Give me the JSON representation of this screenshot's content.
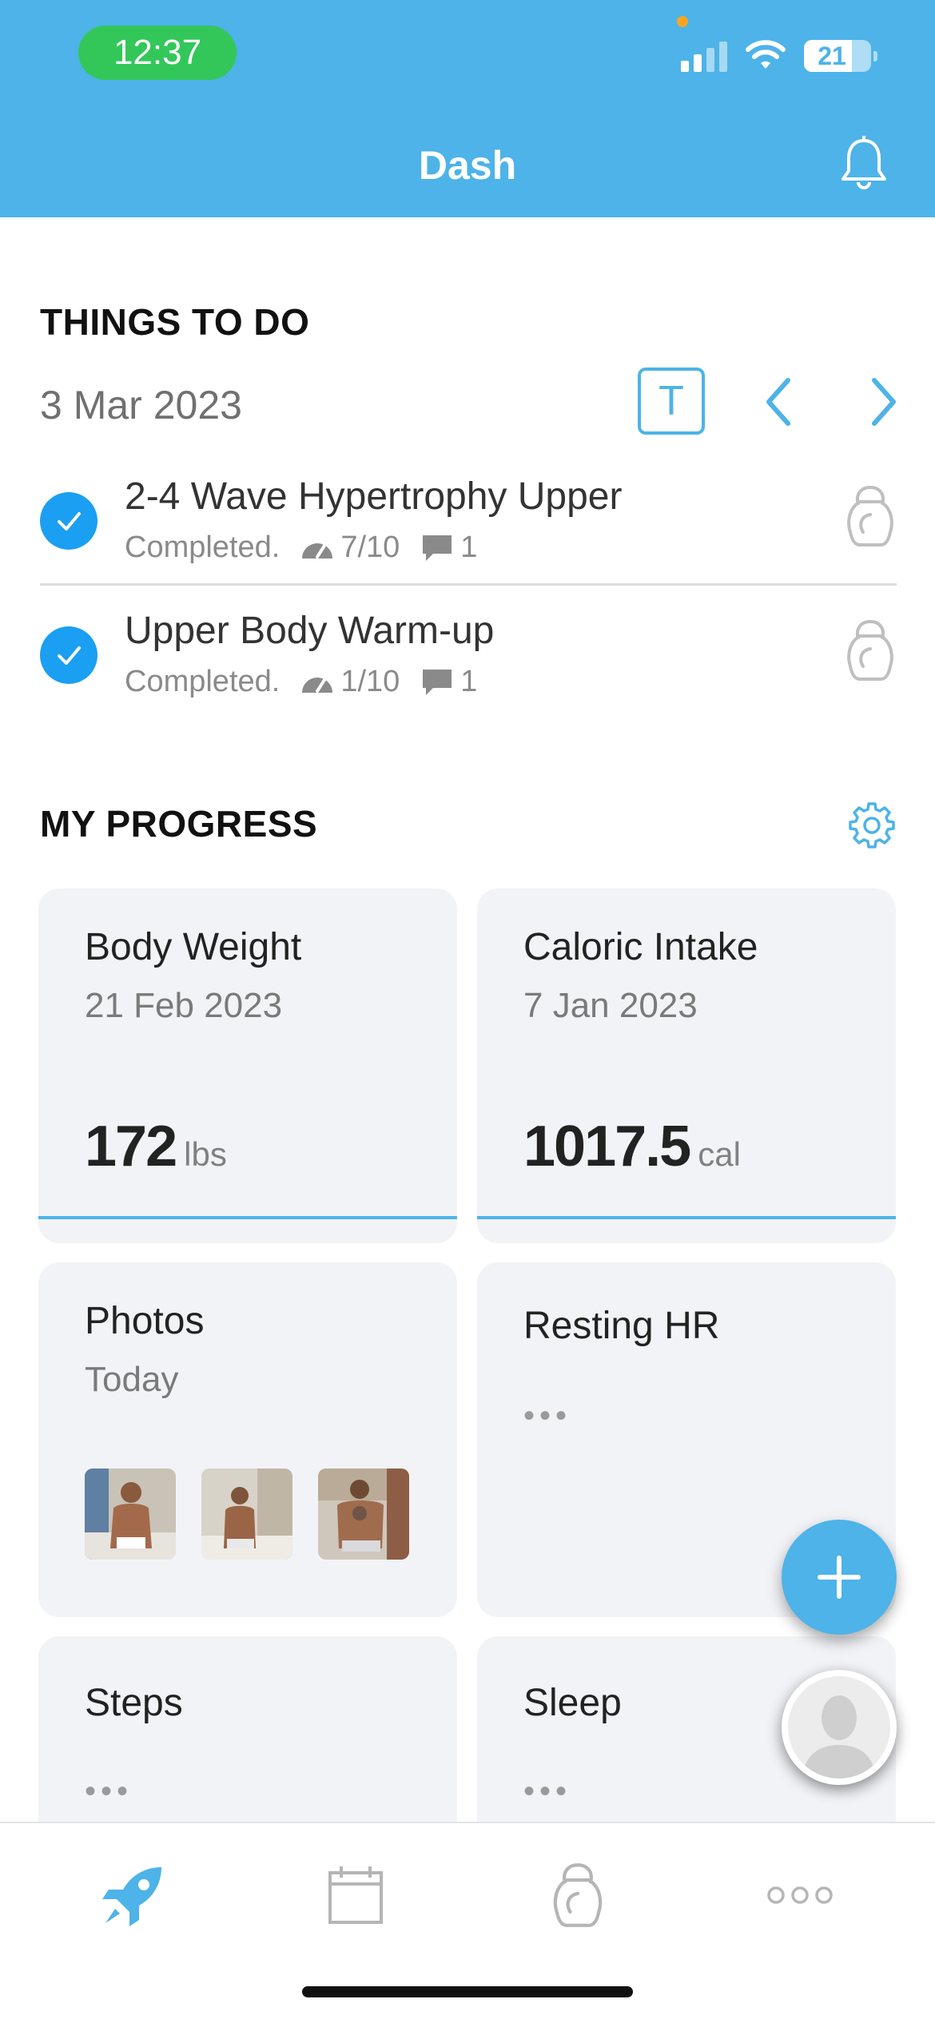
{
  "status_bar": {
    "time": "12:37",
    "battery": "21"
  },
  "header": {
    "title": "Dash"
  },
  "things_to_do": {
    "title": "THINGS TO DO",
    "date": "3 Mar 2023",
    "today_button": "T",
    "tasks": [
      {
        "title": "2-4 Wave Hypertrophy Upper",
        "status": "Completed.",
        "rpe": "7/10",
        "comments": "1"
      },
      {
        "title": "Upper Body Warm-up",
        "status": "Completed.",
        "rpe": "1/10",
        "comments": "1"
      }
    ]
  },
  "progress": {
    "title": "MY PROGRESS",
    "cards": [
      {
        "title": "Body Weight",
        "date": "21 Feb 2023",
        "value": "172",
        "unit": "lbs"
      },
      {
        "title": "Caloric Intake",
        "date": "7 Jan 2023",
        "value": "1017.5",
        "unit": "cal"
      },
      {
        "title": "Photos",
        "date": "Today"
      },
      {
        "title": "Resting HR",
        "placeholder": "•••"
      },
      {
        "title": "Steps",
        "placeholder": "•••"
      },
      {
        "title": "Sleep",
        "placeholder": "•••"
      }
    ]
  },
  "colors": {
    "accent": "#4db3e8",
    "check": "#1a9ff2",
    "status_green": "#33c759"
  },
  "icons": [
    "bell-icon",
    "chevron-left-icon",
    "chevron-right-icon",
    "kettlebell-icon",
    "gear-icon",
    "rocket-icon",
    "calendar-icon",
    "more-icon",
    "plus-icon",
    "avatar-icon"
  ]
}
